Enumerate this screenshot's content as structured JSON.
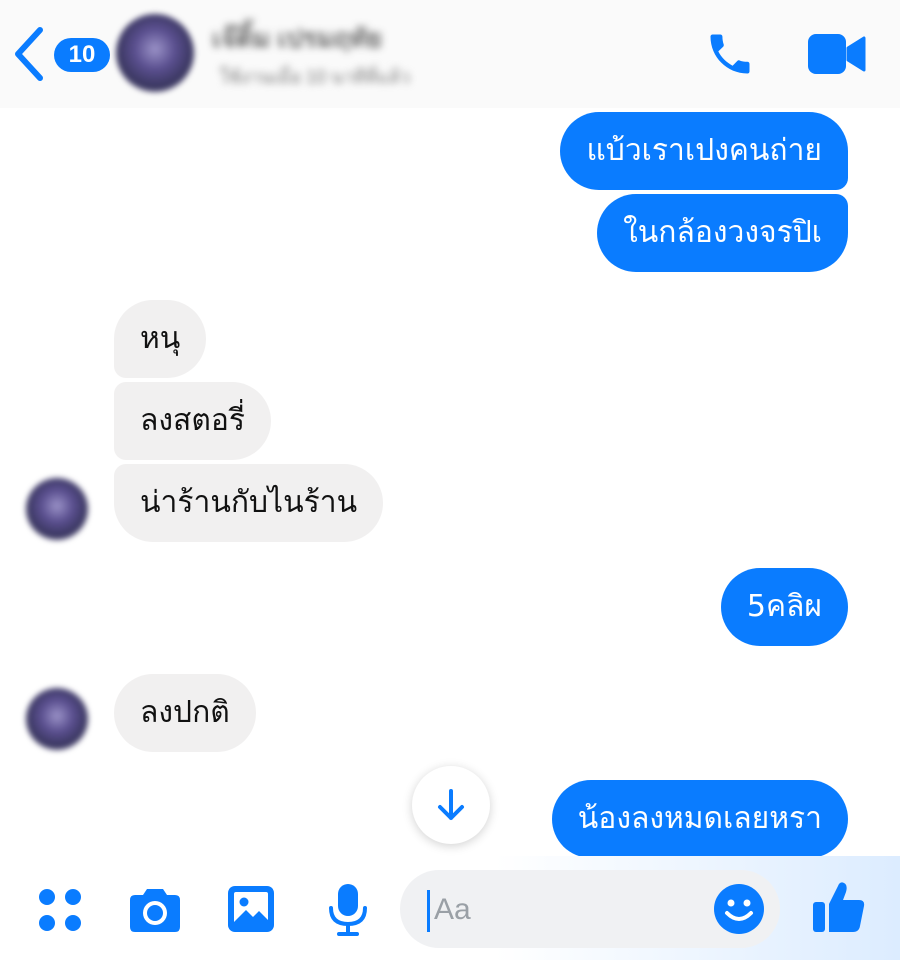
{
  "header": {
    "back_badge_count": "10",
    "contact_name": "เจ๊ติ้ม เปรมฤทัย",
    "contact_status": "ใช้งานเมื่อ 10 นาทีที่แล้ว"
  },
  "messages": [
    {
      "side": "out",
      "text": "แบ้วเราเปงคนถ่าย"
    },
    {
      "side": "out",
      "text": "ในกล้องวงจรปิเ"
    },
    {
      "side": "in",
      "text": "หนุ"
    },
    {
      "side": "in",
      "text": "ลงสตอรี่"
    },
    {
      "side": "in",
      "text": "น่าร้านกับไนร้าน"
    },
    {
      "side": "out",
      "text": "5คลิผ"
    },
    {
      "side": "in",
      "text": "ลงปกติ"
    },
    {
      "side": "out",
      "text": "น้องลงหมดเลยหรา"
    }
  ],
  "composer": {
    "placeholder": "Aa"
  },
  "colors": {
    "accent": "#0a7cff",
    "incoming_bubble": "#f1f0f0",
    "outgoing_text": "#ffffff"
  },
  "icons": {
    "header": [
      "back-chevron-icon",
      "phone-icon",
      "video-camera-icon"
    ],
    "toolbar": [
      "apps-icon",
      "camera-icon",
      "gallery-icon",
      "microphone-icon",
      "emoji-icon",
      "thumbs-up-icon"
    ],
    "scroll": "arrow-down-icon"
  }
}
